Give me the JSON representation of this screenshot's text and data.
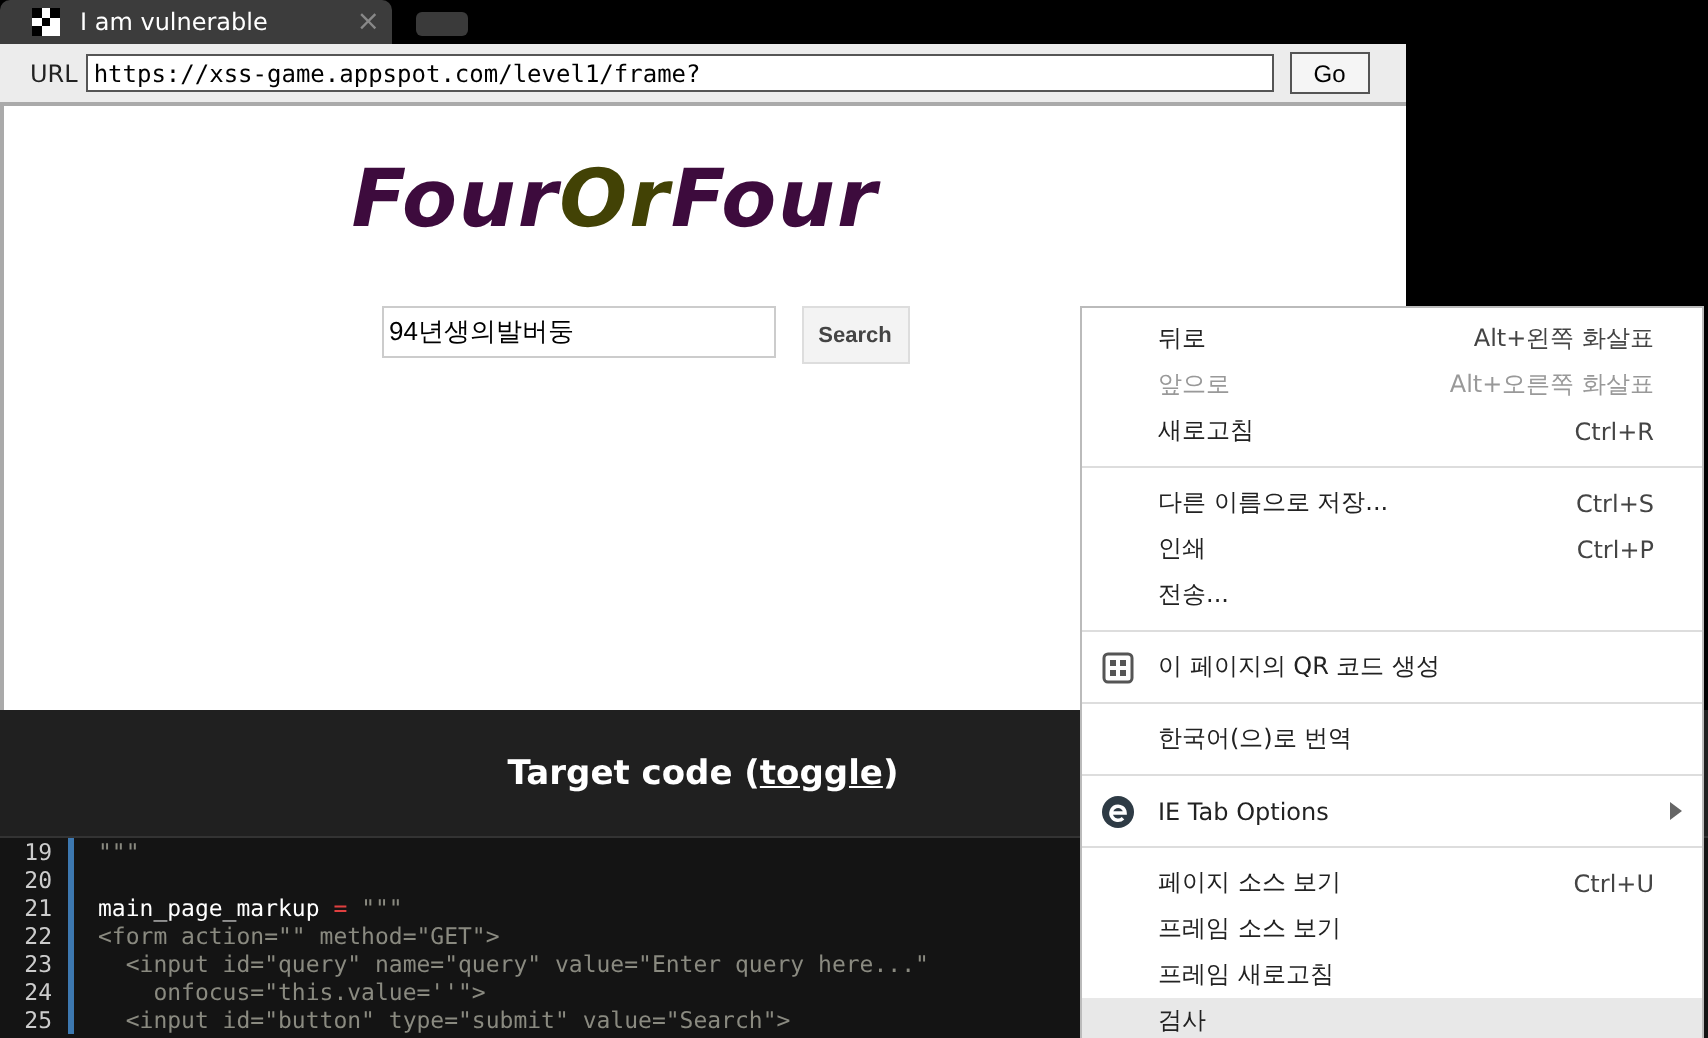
{
  "tab": {
    "title": "I am vulnerable",
    "close": "×"
  },
  "address_bar": {
    "label": "URL",
    "value": "https://xss-game.appspot.com/level1/frame?",
    "go": "Go"
  },
  "page": {
    "logo": [
      {
        "text": "Four",
        "color": "#3d0b3d"
      },
      {
        "text": "Or",
        "color": "#424205"
      },
      {
        "text": "Four",
        "color": "#3d0b3d"
      }
    ],
    "search": {
      "value": "94년생의발버둥",
      "button": "Search"
    }
  },
  "target_code": {
    "title": "Target code (",
    "link": "toggle",
    "close": ")"
  },
  "code": [
    {
      "number": "19",
      "segments": [
        {
          "text": "\"\"\"",
          "kind": "string"
        }
      ]
    },
    {
      "number": "20"
    },
    {
      "number": "21",
      "segments": [
        {
          "text": "main_page_markup",
          "kind": "name"
        },
        {
          "text": " = ",
          "kind": "operator"
        },
        {
          "text": "\"\"\"",
          "kind": "string"
        }
      ]
    },
    {
      "number": "22",
      "segments": [
        {
          "text": "<form action=\"\" method=\"GET\">",
          "kind": "string"
        }
      ]
    },
    {
      "number": "23",
      "segments": [
        {
          "text": "  <input id=\"query\" name=\"query\" value=\"Enter query here...\"",
          "kind": "string"
        }
      ]
    },
    {
      "number": "24",
      "segments": [
        {
          "text": "    onfocus=\"this.value=''\">",
          "kind": "string"
        }
      ]
    },
    {
      "number": "25",
      "segments": [
        {
          "text": "  <input id=\"button\" type=\"submit\" value=\"Search\">",
          "kind": "string"
        }
      ]
    }
  ],
  "context_menu": {
    "groups": [
      [
        {
          "kind": "plain",
          "label": "뒤로",
          "shortcut": "Alt+왼쪽 화살표",
          "disabled": false,
          "selected": false
        },
        {
          "kind": "plain",
          "label": "앞으로",
          "shortcut": "Alt+오른쪽 화살표",
          "disabled": true,
          "selected": false
        },
        {
          "kind": "plain",
          "label": "새로고침",
          "shortcut": "Ctrl+R",
          "disabled": false,
          "selected": false
        }
      ],
      [
        {
          "kind": "plain",
          "label": "다른 이름으로 저장...",
          "shortcut": "Ctrl+S",
          "disabled": false,
          "selected": false
        },
        {
          "kind": "plain",
          "label": "인쇄",
          "shortcut": "Ctrl+P",
          "disabled": false,
          "selected": false
        },
        {
          "kind": "plain",
          "label": "전송...",
          "disabled": false,
          "selected": false
        }
      ],
      [
        {
          "kind": "qr",
          "label": "이 페이지의 QR 코드 생성",
          "disabled": false,
          "selected": false
        }
      ],
      [
        {
          "kind": "plain",
          "label": "한국어(으)로 번역",
          "disabled": false,
          "selected": false
        }
      ],
      [
        {
          "kind": "extension",
          "label": "IE Tab Options",
          "submenu": true,
          "disabled": false,
          "selected": false
        }
      ],
      [
        {
          "kind": "plain",
          "label": "페이지 소스 보기",
          "shortcut": "Ctrl+U",
          "disabled": false,
          "selected": false
        },
        {
          "kind": "plain",
          "label": "프레임 소스 보기",
          "disabled": false,
          "selected": false
        },
        {
          "kind": "plain",
          "label": "프레임 새로고침",
          "disabled": false,
          "selected": false
        },
        {
          "kind": "plain",
          "label": "검사",
          "disabled": false,
          "selected": true
        }
      ]
    ]
  }
}
